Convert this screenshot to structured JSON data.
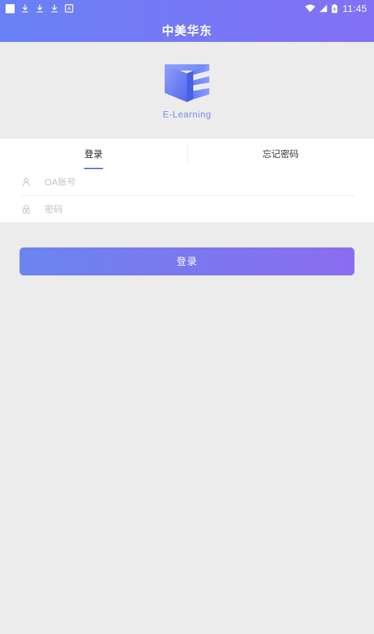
{
  "statusbar": {
    "time": "11:45",
    "left_icons": [
      "white-square-icon",
      "download-icon",
      "download-icon",
      "download-icon",
      "a-box-icon"
    ],
    "right_icons": [
      "wifi-icon",
      "signal-icon",
      "battery-charging-icon"
    ]
  },
  "header": {
    "title": "中美华东",
    "gradient_start": "#6a81f5",
    "gradient_end": "#8270f5"
  },
  "logo": {
    "caption": "E-Learning",
    "caption_color": "#7b86f0",
    "mark_light": "#7f94f7",
    "mark_dark": "#4a5fe8"
  },
  "tabs": [
    {
      "label": "登录",
      "active": true
    },
    {
      "label": "忘记密码",
      "active": false
    }
  ],
  "form": {
    "fields": [
      {
        "icon": "user-icon",
        "placeholder": "OA账号",
        "value": ""
      },
      {
        "icon": "lock-icon",
        "placeholder": "密码",
        "value": ""
      }
    ]
  },
  "actions": {
    "login_label": "登录",
    "login_gradient_start": "#6b84f0",
    "login_gradient_end": "#8b6cf0"
  },
  "theme": {
    "page_background": "#ececec",
    "panel_background": "#ffffff",
    "accent": "#5f72e8"
  }
}
